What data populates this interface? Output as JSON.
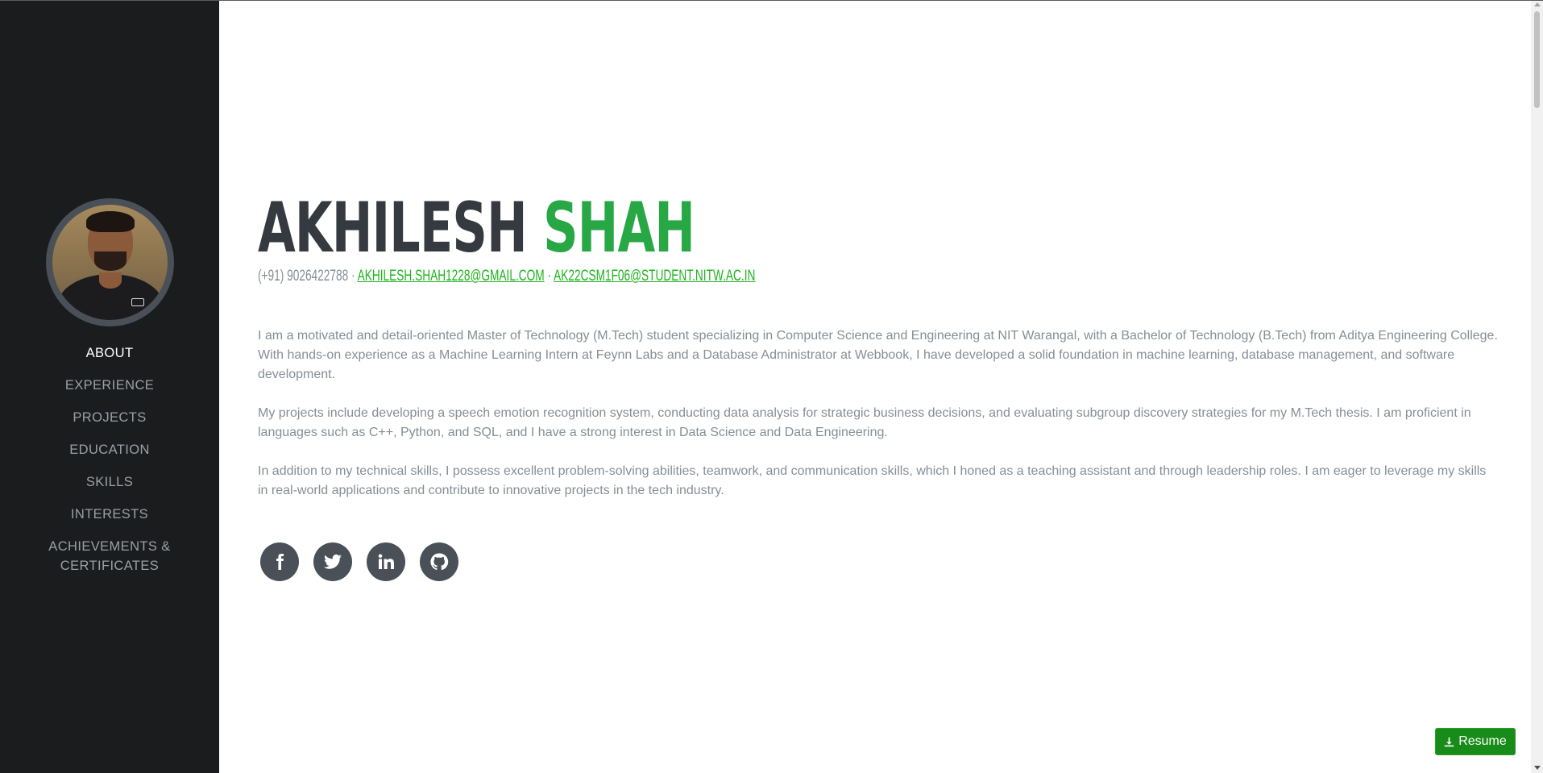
{
  "profile": {
    "avatar_alt": "profile photo"
  },
  "nav": {
    "items": [
      {
        "label": "About",
        "active": true
      },
      {
        "label": "Experience",
        "active": false
      },
      {
        "label": "Projects",
        "active": false
      },
      {
        "label": "Education",
        "active": false
      },
      {
        "label": "Skills",
        "active": false
      },
      {
        "label": "Interests",
        "active": false
      },
      {
        "label": "Achievements & Certificates",
        "active": false
      }
    ]
  },
  "header": {
    "first_name": "Akhilesh",
    "last_name": "Shah",
    "phone": "(+91) 9026422788 ·",
    "email_1": "akhilesh.shah1228@gmail.com",
    "separator": "·",
    "email_2": "ak22csm1f06@student.nitw.ac.in"
  },
  "bio": {
    "paragraphs": [
      "I am a motivated and detail-oriented Master of Technology (M.Tech) student specializing in Computer Science and Engineering at NIT Warangal, with a Bachelor of Technology (B.Tech) from Aditya Engineering College. With hands-on experience as a Machine Learning Intern at Feynn Labs and a Database Administrator at Webbook, I have developed a solid foundation in machine learning, database management, and software development.",
      "My projects include developing a speech emotion recognition system, conducting data analysis for strategic business decisions, and evaluating subgroup discovery strategies for my M.Tech thesis. I am proficient in languages such as C++, Python, and SQL, and I have a strong interest in Data Science and Data Engineering.",
      "In addition to my technical skills, I possess excellent problem-solving abilities, teamwork, and communication skills, which I honed as a teaching assistant and through leadership roles. I am eager to leverage my skills in real-world applications and contribute to innovative projects in the tech industry."
    ]
  },
  "social": [
    {
      "icon": "facebook-icon"
    },
    {
      "icon": "twitter-icon"
    },
    {
      "icon": "linkedin-icon"
    },
    {
      "icon": "github-icon"
    }
  ],
  "resume_button": {
    "label": "Resume",
    "icon": "download-icon"
  },
  "colors": {
    "sidebar_bg": "#1b1c1e",
    "accent_green": "#28a745",
    "email_green": "#1db31d",
    "name_dark": "#343a40",
    "button_green": "#198b19"
  }
}
